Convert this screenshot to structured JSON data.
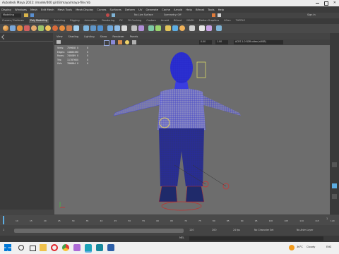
{
  "window": {
    "title": "Autodesk Maya 2022: /model/400 girl/3/maya/maya-file.mb",
    "menu": [
      "Display",
      "Windows",
      "Mesh",
      "Edit Mesh",
      "Mesh Tools",
      "Mesh Display",
      "Curves",
      "Surfaces",
      "Deform",
      "UV",
      "Generate",
      "Cache",
      "Arnold",
      "Help",
      "Bifrost",
      "Tools",
      "Help"
    ]
  },
  "status_line": {
    "mode": "Modeling",
    "no_live_surface": "No Live Surface",
    "symmetry": "Symmetry: Off",
    "sign_in": "Sign In"
  },
  "shelf_tabs": [
    "Curves / Surfaces",
    "Poly Modeling",
    "Sculpting",
    "Rigging",
    "Animation",
    "Rendering",
    "FX",
    "FX Caching",
    "Custom",
    "Arnold",
    "Bifrost",
    "MASH",
    "Motion Graphics",
    "XGen",
    "TURTLE"
  ],
  "viewport": {
    "menu": [
      "View",
      "Shading",
      "Lighting",
      "Show",
      "Renderer",
      "Panels"
    ],
    "hud_rows": [
      {
        "label": "Verts:",
        "a": "759608",
        "b": "0",
        "c": "0"
      },
      {
        "label": "Edges:",
        "a": "1488049",
        "b": "0",
        "c": "0"
      },
      {
        "label": "Faces:",
        "a": "740089",
        "b": "0",
        "c": "0"
      },
      {
        "label": "Tris:",
        "a": "1178760",
        "b": "0",
        "c": "0"
      },
      {
        "label": "UVs:",
        "a": "786864",
        "b": "0",
        "c": "0"
      }
    ],
    "toolbar_fields": [
      "0.00",
      "1.00",
      "ACES 1.0 SDR-video (sRGB)"
    ]
  },
  "timeline": {
    "ticks": [
      "5",
      "10",
      "15",
      "20",
      "25",
      "30",
      "35",
      "40",
      "45",
      "50",
      "55",
      "60",
      "65",
      "70",
      "75",
      "80",
      "85",
      "90",
      "95",
      "100",
      "105",
      "110",
      "115",
      "120"
    ],
    "current_frame": "1"
  },
  "range": {
    "start": "1",
    "end": "120",
    "anim_end": "200",
    "character_set": "No Character Set",
    "anim_layer": "No Anim Layer",
    "fps": "24 fps"
  },
  "command_line": {
    "lang": "MEL"
  },
  "taskbar": {
    "weather": "36°C",
    "weather_desc": "Cloudy",
    "lang": "ENG"
  },
  "colors": {
    "wire": "#3a3de0",
    "shirt": "#8a8ad8",
    "pants": "#2a2f86",
    "accent": "#5dade2"
  }
}
